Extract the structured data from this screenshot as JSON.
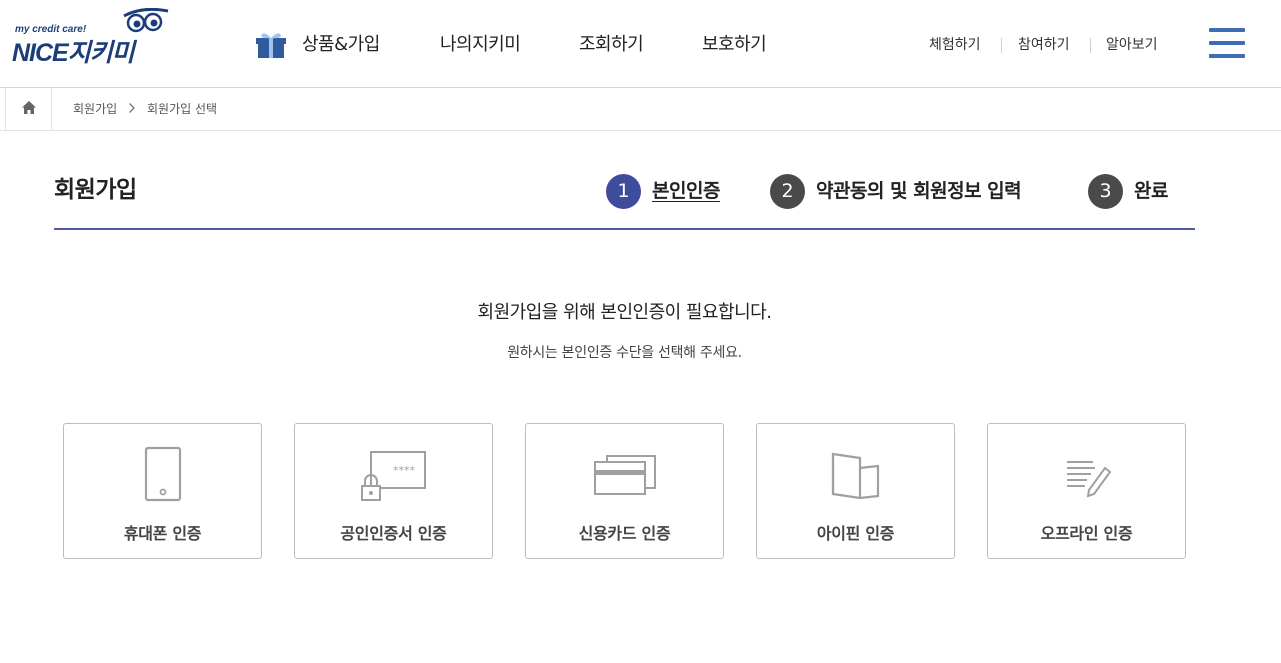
{
  "logo": {
    "tagline": "my credit care!",
    "wordmark": "NICE지키미"
  },
  "gnb": [
    {
      "label": "상품&가입",
      "icon": "gift-icon"
    },
    {
      "label": "나의지키미"
    },
    {
      "label": "조회하기"
    },
    {
      "label": "보호하기"
    }
  ],
  "util": [
    "체험하기",
    "참여하기",
    "알아보기"
  ],
  "breadcrumb": {
    "items": [
      "회원가입",
      "회원가입 선택"
    ]
  },
  "page_title": "회원가입",
  "steps": [
    {
      "num": "1",
      "label": "본인인증"
    },
    {
      "num": "2",
      "label": "약관동의 및 회원정보 입력"
    },
    {
      "num": "3",
      "label": "완료"
    }
  ],
  "intro": {
    "main": "회원가입을 위해 본인인증이 필요합니다.",
    "sub": "원하시는 본인인증 수단을 선택해 주세요."
  },
  "auth_options": [
    {
      "label": "휴대폰 인증",
      "icon": "mobile-phone-icon"
    },
    {
      "label": "공인인증서 인증",
      "icon": "certificate-lock-icon"
    },
    {
      "label": "신용카드 인증",
      "icon": "credit-card-icon"
    },
    {
      "label": "아이핀 인증",
      "icon": "ipin-icon"
    },
    {
      "label": "오프라인 인증",
      "icon": "document-pen-icon"
    }
  ],
  "colors": {
    "accent": "#3f4c9c",
    "brand": "#1c3d78",
    "menu": "#3d6eb4",
    "step_inactive": "#4a4a4a"
  }
}
